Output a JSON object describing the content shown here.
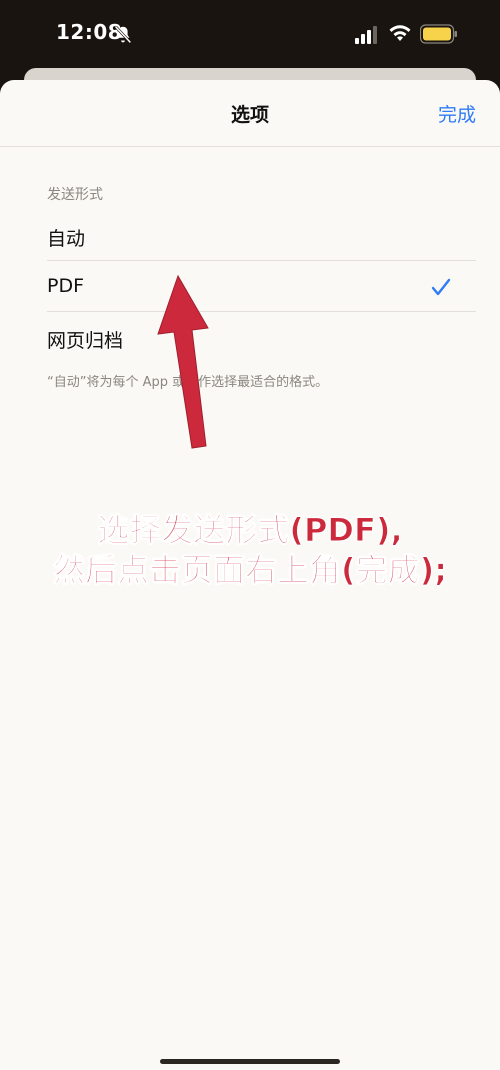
{
  "status_bar": {
    "time": "12:08",
    "icons": [
      "bell-slash-icon",
      "cellular-signal-icon",
      "wifi-icon",
      "battery-icon"
    ],
    "battery_color": "#f6d34a"
  },
  "nav": {
    "title": "选项",
    "done_label": "完成"
  },
  "send_format": {
    "header": "发送形式",
    "options": [
      {
        "label": "自动",
        "selected": false
      },
      {
        "label": "PDF",
        "selected": true
      },
      {
        "label": "网页归档",
        "selected": false
      }
    ],
    "footer": "“自动”将为每个 App 或操作选择最适合的格式。"
  },
  "annotation": {
    "line1": "选择发送形式(PDF),",
    "line2": "然后点击页面右上角(完成);",
    "color": "#cc2a3c"
  },
  "colors": {
    "accent": "#2f7cf6",
    "sheet_bg": "#fbf9f5"
  }
}
